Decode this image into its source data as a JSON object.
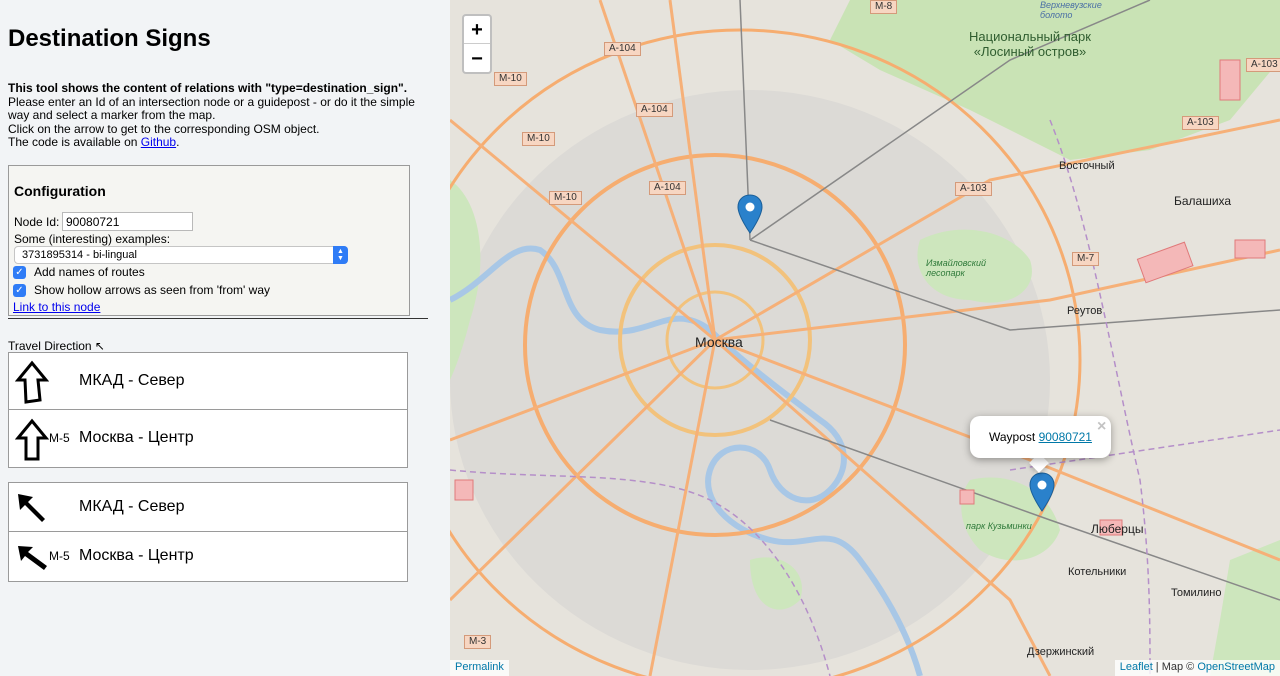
{
  "title": "Destination Signs",
  "intro": {
    "bold_line": "This tool shows the content of relations with \"type=destination_sign\".",
    "line2": "Please enter an Id of an intersection node or a guidepost - or do it the simple way and select a marker from the map.",
    "line3": "Click on the arrow to get to the corresponding OSM object.",
    "line4_prefix": "The code is available on ",
    "github_link": "Github",
    "line4_suffix": "."
  },
  "config": {
    "title": "Configuration",
    "node_id_label": "Node Id:",
    "node_id_value": "90080721",
    "examples_label": "Some (interesting) examples:",
    "examples_selected": "3731895314 - bi-lingual",
    "checkbox_routes": "Add names of routes",
    "checkbox_hollow": "Show hollow arrows as seen from 'from' way",
    "link_to_node": "Link to this node"
  },
  "travel": {
    "label": "Travel Direction",
    "arrow_glyph": "↖"
  },
  "signs": [
    {
      "rows": [
        {
          "arrow": "hollow-up-icon",
          "ref": "",
          "destination": "МКАД - Север"
        },
        {
          "arrow": "hollow-up-icon",
          "ref": "M-5",
          "destination": "Москва - Центр"
        }
      ]
    },
    {
      "rows": [
        {
          "arrow": "solid-up-left-icon",
          "ref": "",
          "destination": "МКАД - Север"
        },
        {
          "arrow": "solid-up-left-icon",
          "ref": "M-5",
          "destination": "Москва - Центр"
        }
      ]
    }
  ],
  "map": {
    "zoom_in": "+",
    "zoom_out": "−",
    "city_labels": {
      "moscow": "Москва",
      "balashikha": "Балашиха",
      "reutov": "Реутов",
      "vostochny": "Восточный",
      "lyubertsy": "Люберцы",
      "kotelniki": "Котельники",
      "tomilino": "Томилино",
      "dzerzhinsky": "Дзержинский"
    },
    "park_label": "Национальный парк «Лосиный остров»",
    "green_labels": {
      "izmaylovsky": "Измайловский лесопарк",
      "kuzminki": "парк Кузьминки",
      "verkhnevyuzskoe": "Верхневузские болото"
    },
    "road_labels": [
      "A-104",
      "M-10",
      "A-104",
      "M-10",
      "A-104",
      "M-10",
      "A-103",
      "A-103",
      "A-103",
      "M-7",
      "M-3",
      "M-8"
    ],
    "popup": {
      "prefix": "Waypost ",
      "link": "90080721",
      "close": "×"
    },
    "permalink": "Permalink",
    "attribution": {
      "leaflet": "Leaflet",
      "middle": " | Map © ",
      "osm": "OpenStreetMap"
    }
  }
}
